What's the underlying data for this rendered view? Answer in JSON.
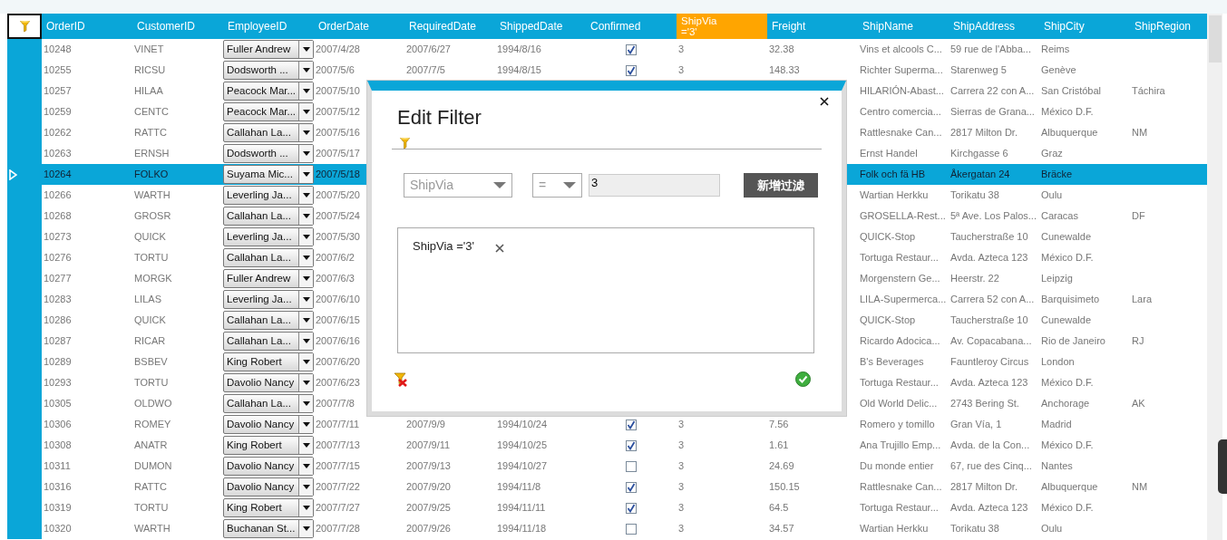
{
  "grid": {
    "columns": [
      {
        "label": "OrderID"
      },
      {
        "label": "CustomerID"
      },
      {
        "label": "EmployeeID"
      },
      {
        "label": "OrderDate"
      },
      {
        "label": "RequiredDate"
      },
      {
        "label": "ShippedDate"
      },
      {
        "label": "Confirmed"
      },
      {
        "label": "ShipVia",
        "filter": "='3'"
      },
      {
        "label": "Freight"
      },
      {
        "label": "ShipName"
      },
      {
        "label": "ShipAddress"
      },
      {
        "label": "ShipCity"
      },
      {
        "label": "ShipRegion"
      }
    ],
    "rows": [
      {
        "selected": false,
        "order_id": "10248",
        "customer_id": "VINET",
        "employee": "Fuller Andrew",
        "order_date": "2007/4/28",
        "required_date": "2007/6/27",
        "shipped_date": "1994/8/16",
        "confirmed": true,
        "ship_via": "3",
        "freight": "32.38",
        "ship_name": "Vins et alcools C...",
        "ship_address": "59 rue de l'Abba...",
        "ship_city": "Reims"
      },
      {
        "selected": false,
        "order_id": "10255",
        "customer_id": "RICSU",
        "employee": "Dodsworth ...",
        "order_date": "2007/5/6",
        "required_date": "2007/7/5",
        "shipped_date": "1994/8/15",
        "confirmed": true,
        "ship_via": "3",
        "freight": "148.33",
        "ship_name": "Richter Superma...",
        "ship_address": "Starenweg 5",
        "ship_city": "Genève"
      },
      {
        "selected": false,
        "order_id": "10257",
        "customer_id": "HILAA",
        "employee": "Peacock Mar...",
        "order_date": "2007/5/10",
        "ship_name": "HILARIÓN-Abast...",
        "ship_address": "Carrera 22 con A...",
        "ship_city": "San Cristóbal",
        "ship_region": "Táchira"
      },
      {
        "selected": false,
        "order_id": "10259",
        "customer_id": "CENTC",
        "employee": "Peacock Mar...",
        "order_date": "2007/5/12",
        "ship_name": "Centro comercia...",
        "ship_address": "Sierras de Grana...",
        "ship_city": "México D.F."
      },
      {
        "selected": false,
        "order_id": "10262",
        "customer_id": "RATTC",
        "employee": "Callahan La...",
        "order_date": "2007/5/16",
        "ship_name": "Rattlesnake Can...",
        "ship_address": "2817 Milton Dr.",
        "ship_city": "Albuquerque",
        "ship_region": "NM"
      },
      {
        "selected": false,
        "order_id": "10263",
        "customer_id": "ERNSH",
        "employee": "Dodsworth ...",
        "order_date": "2007/5/17",
        "ship_name": "Ernst Handel",
        "ship_address": "Kirchgasse 6",
        "ship_city": "Graz"
      },
      {
        "selected": true,
        "order_id": "10264",
        "customer_id": "FOLKO",
        "employee": "Suyama Mic...",
        "order_date": "2007/5/18",
        "ship_name": "Folk och fä HB",
        "ship_address": "Åkergatan 24",
        "ship_city": "Bräcke"
      },
      {
        "selected": false,
        "order_id": "10266",
        "customer_id": "WARTH",
        "employee": "Leverling Ja...",
        "order_date": "2007/5/20",
        "ship_name": "Wartian Herkku",
        "ship_address": "Torikatu 38",
        "ship_city": "Oulu"
      },
      {
        "selected": false,
        "order_id": "10268",
        "customer_id": "GROSR",
        "employee": "Callahan La...",
        "order_date": "2007/5/24",
        "ship_name": "GROSELLA-Rest...",
        "ship_address": "5ª Ave. Los Palos...",
        "ship_city": "Caracas",
        "ship_region": "DF"
      },
      {
        "selected": false,
        "order_id": "10273",
        "customer_id": "QUICK",
        "employee": "Leverling Ja...",
        "order_date": "2007/5/30",
        "ship_name": "QUICK-Stop",
        "ship_address": "Taucherstraße 10",
        "ship_city": "Cunewalde"
      },
      {
        "selected": false,
        "order_id": "10276",
        "customer_id": "TORTU",
        "employee": "Callahan La...",
        "order_date": "2007/6/2",
        "ship_name": "Tortuga Restaur...",
        "ship_address": "Avda. Azteca 123",
        "ship_city": "México D.F."
      },
      {
        "selected": false,
        "order_id": "10277",
        "customer_id": "MORGK",
        "employee": "Fuller Andrew",
        "order_date": "2007/6/3",
        "ship_name": "Morgenstern Ge...",
        "ship_address": "Heerstr. 22",
        "ship_city": "Leipzig"
      },
      {
        "selected": false,
        "order_id": "10283",
        "customer_id": "LILAS",
        "employee": "Leverling Ja...",
        "order_date": "2007/6/10",
        "ship_name": "LILA-Supermerca...",
        "ship_address": "Carrera 52 con A...",
        "ship_city": "Barquisimeto",
        "ship_region": "Lara"
      },
      {
        "selected": false,
        "order_id": "10286",
        "customer_id": "QUICK",
        "employee": "Callahan La...",
        "order_date": "2007/6/15",
        "ship_name": "QUICK-Stop",
        "ship_address": "Taucherstraße 10",
        "ship_city": "Cunewalde"
      },
      {
        "selected": false,
        "order_id": "10287",
        "customer_id": "RICAR",
        "employee": "Callahan La...",
        "order_date": "2007/6/16",
        "ship_name": "Ricardo Adocica...",
        "ship_address": "Av. Copacabana...",
        "ship_city": "Rio de Janeiro",
        "ship_region": "RJ"
      },
      {
        "selected": false,
        "order_id": "10289",
        "customer_id": "BSBEV",
        "employee": "King Robert",
        "order_date": "2007/6/20",
        "ship_name": "B's Beverages",
        "ship_address": "Fauntleroy Circus",
        "ship_city": "London"
      },
      {
        "selected": false,
        "order_id": "10293",
        "customer_id": "TORTU",
        "employee": "Davolio Nancy",
        "order_date": "2007/6/23",
        "ship_name": "Tortuga Restaur...",
        "ship_address": "Avda. Azteca 123",
        "ship_city": "México D.F."
      },
      {
        "selected": false,
        "order_id": "10305",
        "customer_id": "OLDWO",
        "employee": "Callahan La...",
        "order_date": "2007/7/8",
        "ship_name": "Old World Delic...",
        "ship_address": "2743 Bering St.",
        "ship_city": "Anchorage",
        "ship_region": "AK"
      },
      {
        "selected": false,
        "order_id": "10306",
        "customer_id": "ROMEY",
        "employee": "Davolio Nancy",
        "order_date": "2007/7/11",
        "required_date": "2007/9/9",
        "shipped_date": "1994/10/24",
        "confirmed": true,
        "ship_via": "3",
        "freight": "7.56",
        "ship_name": "Romero y tomillo",
        "ship_address": "Gran Vía, 1",
        "ship_city": "Madrid"
      },
      {
        "selected": false,
        "order_id": "10308",
        "customer_id": "ANATR",
        "employee": "King Robert",
        "order_date": "2007/7/13",
        "required_date": "2007/9/11",
        "shipped_date": "1994/10/25",
        "confirmed": true,
        "ship_via": "3",
        "freight": "1.61",
        "ship_name": "Ana Trujillo Emp...",
        "ship_address": "Avda. de la Con...",
        "ship_city": "México D.F."
      },
      {
        "selected": false,
        "order_id": "10311",
        "customer_id": "DUMON",
        "employee": "Davolio Nancy",
        "order_date": "2007/7/15",
        "required_date": "2007/9/13",
        "shipped_date": "1994/10/27",
        "confirmed": false,
        "ship_via": "3",
        "freight": "24.69",
        "ship_name": "Du monde entier",
        "ship_address": "67, rue des Cinq...",
        "ship_city": "Nantes"
      },
      {
        "selected": false,
        "order_id": "10316",
        "customer_id": "RATTC",
        "employee": "Davolio Nancy",
        "order_date": "2007/7/22",
        "required_date": "2007/9/20",
        "shipped_date": "1994/11/8",
        "confirmed": true,
        "ship_via": "3",
        "freight": "150.15",
        "ship_name": "Rattlesnake Can...",
        "ship_address": "2817 Milton Dr.",
        "ship_city": "Albuquerque",
        "ship_region": "NM"
      },
      {
        "selected": false,
        "order_id": "10319",
        "customer_id": "TORTU",
        "employee": "King Robert",
        "order_date": "2007/7/27",
        "required_date": "2007/9/25",
        "shipped_date": "1994/11/11",
        "confirmed": true,
        "ship_via": "3",
        "freight": "64.5",
        "ship_name": "Tortuga Restaur...",
        "ship_address": "Avda. Azteca 123",
        "ship_city": "México D.F."
      },
      {
        "selected": false,
        "order_id": "10320",
        "customer_id": "WARTH",
        "employee": "Buchanan St...",
        "order_date": "2007/7/28",
        "required_date": "2007/9/26",
        "shipped_date": "1994/11/18",
        "confirmed": false,
        "ship_via": "3",
        "freight": "34.57",
        "ship_name": "Wartian Herkku",
        "ship_address": "Torikatu 38",
        "ship_city": "Oulu"
      }
    ]
  },
  "dialog": {
    "title": "Edit Filter",
    "field": "ShipVia",
    "operator": "=",
    "value": "3",
    "add_button": "新增过滤",
    "filters": [
      {
        "text": "ShipVia ='3'"
      }
    ]
  }
}
